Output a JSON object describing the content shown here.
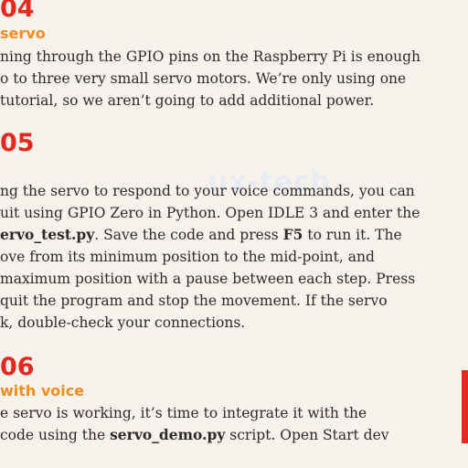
{
  "steps": [
    {
      "number": "04",
      "subtitle": "servo",
      "lines": [
        "ning through the GPIO pins on the Raspberry Pi is enough",
        "o to three very small servo motors. We’re only using one",
        "tutorial, so we aren’t going to add additional power."
      ]
    },
    {
      "number": "05",
      "lines": [
        "ng the servo to respond to your voice commands, you can",
        "uit using GPIO Zero in Python. Open IDLE 3 and enter the",
        "ervo_test.py. Save the code and press F5 to run it. The",
        "ove from its minimum position to the mid-point, and",
        "maximum position with a pause between each step. Press",
        "quit the program and stop the movement. If the servo",
        "k, double-check your connections."
      ],
      "line3": {
        "bold_start": "ervo_test.py",
        "mid": ". Save the code and press ",
        "bold_key": "F5",
        "end": " to run it. The"
      }
    },
    {
      "number": "06",
      "subtitle": "with voice",
      "lines": [
        "e servo is working, it’s time to integrate it with the",
        " code using the servo_demo.py script. Open Start dev"
      ],
      "line2": {
        "start": " code using the ",
        "bold": "servo_demo.py",
        "end": " script. Open Start dev"
      }
    }
  ],
  "watermark": "ux-tech",
  "colors": {
    "step_number": "#e8281e",
    "subtitle": "#f28c1f",
    "body_text": "#2b2b2b",
    "background": "#f7f3ec",
    "accent_bar": "#e8281e"
  }
}
